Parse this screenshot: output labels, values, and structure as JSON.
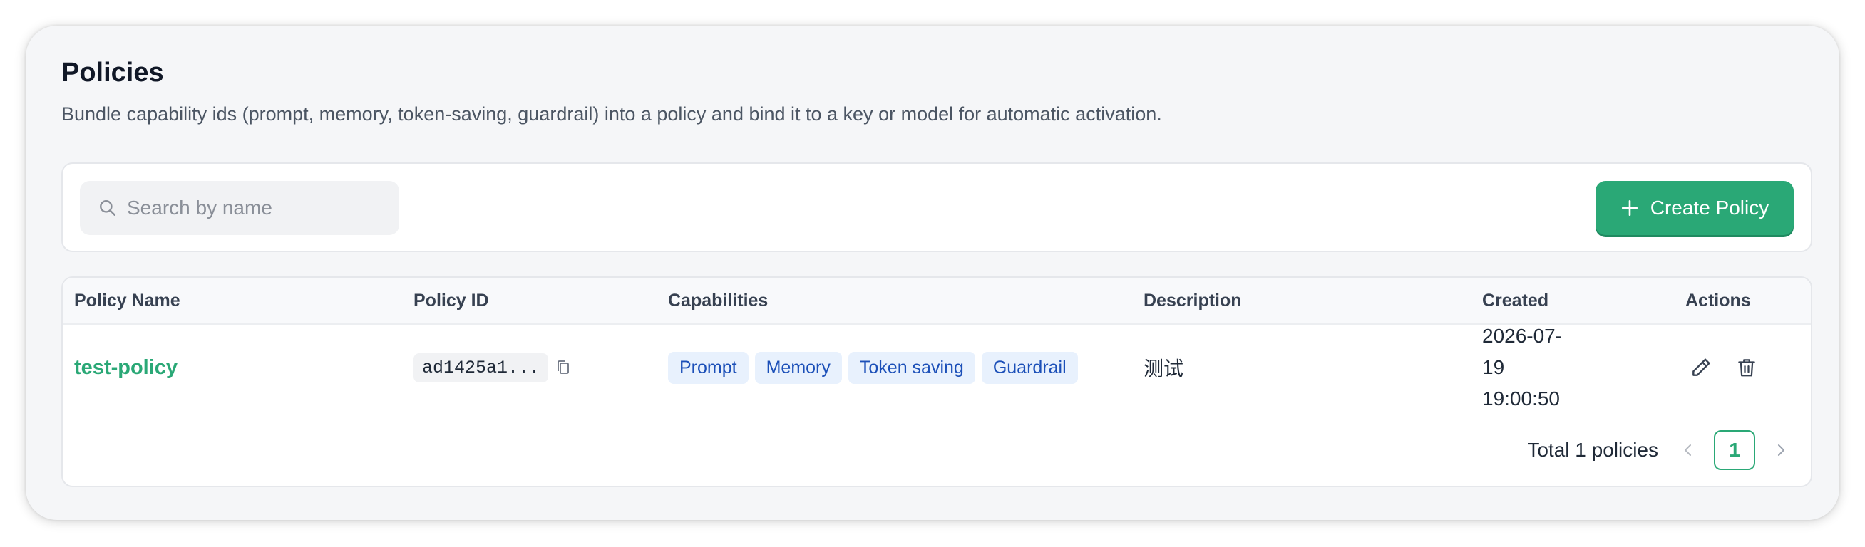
{
  "header": {
    "title": "Policies",
    "subtitle": "Bundle capability ids (prompt, memory, token-saving, guardrail) into a policy and bind it to a key or model for automatic activation."
  },
  "toolbar": {
    "search_placeholder": "Search by name",
    "search_value": "",
    "create_label": "Create Policy",
    "search_icon": "search-icon",
    "create_icon": "plus-icon"
  },
  "table": {
    "columns": {
      "name": "Policy Name",
      "id": "Policy ID",
      "capabilities": "Capabilities",
      "description": "Description",
      "created": "Created",
      "actions": "Actions"
    },
    "rows": [
      {
        "name": "test-policy",
        "id_short": "ad1425a1...",
        "capabilities": [
          "Prompt",
          "Memory",
          "Token saving",
          "Guardrail"
        ],
        "description": "测试",
        "created_date": "2026-07-19",
        "created_time": "19:00:50"
      }
    ]
  },
  "pagination": {
    "total_label": "Total 1 policies",
    "current_page": "1"
  },
  "colors": {
    "accent": "#2aa876",
    "tag_bg": "#e8f1fd",
    "tag_text": "#1b4fb8",
    "title": "#111827",
    "frame_bg": "#f5f6f8"
  }
}
